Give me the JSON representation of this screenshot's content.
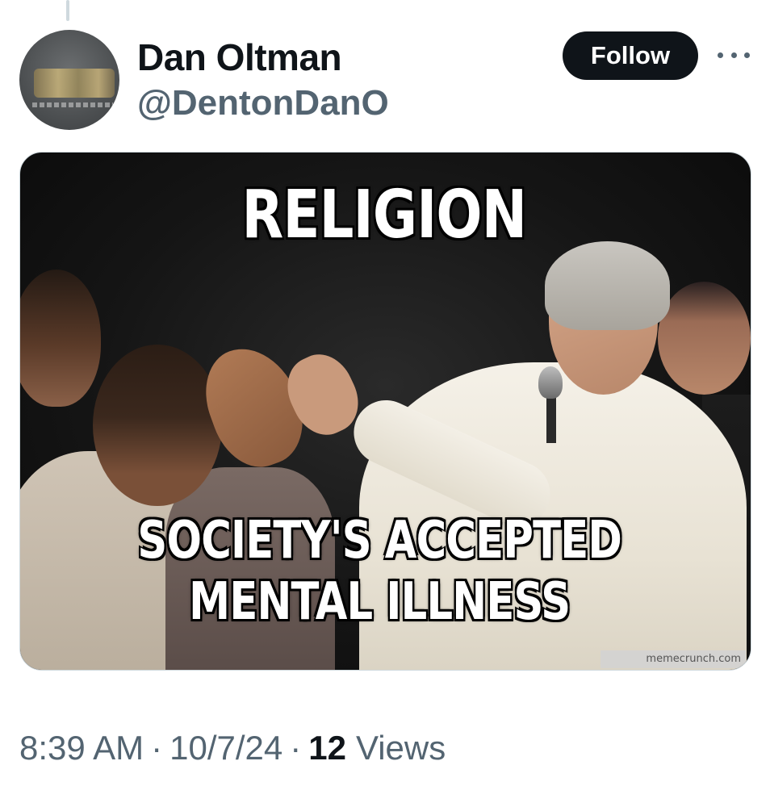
{
  "author": {
    "display_name": "Dan Oltman",
    "handle": "@DentonDanO"
  },
  "actions": {
    "follow_label": "Follow"
  },
  "media": {
    "meme_top_text": "RELIGION",
    "meme_bottom_line1": "SOCIETY'S ACCEPTED",
    "meme_bottom_line2": "MENTAL ILLNESS",
    "watermark": "memecrunch.com"
  },
  "meta": {
    "time": "8:39 AM",
    "separator": "·",
    "date": "10/7/24",
    "views_count": "12",
    "views_label": "Views"
  }
}
